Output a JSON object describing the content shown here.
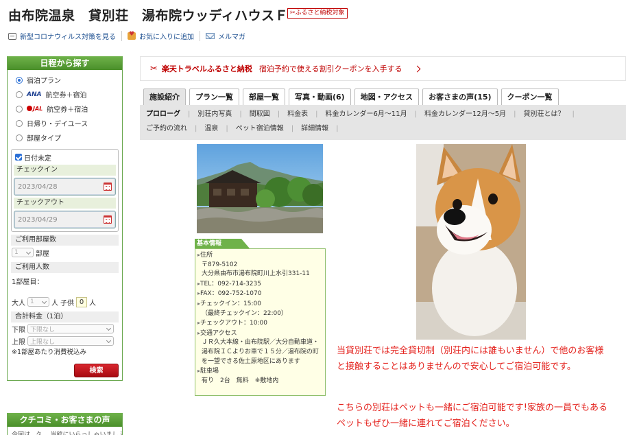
{
  "header": {
    "title": "由布院温泉　貸別荘　湯布院ウッディハウスＦ",
    "badge": "ふるさと納税対象"
  },
  "toplinks": [
    {
      "label": "新型コロナウィルス対策を見る",
      "icon": "info-box-icon"
    },
    {
      "label": "お気に入りに追加",
      "icon": "favorite-icon"
    },
    {
      "label": "メルマガ",
      "icon": "mail-icon"
    }
  ],
  "sidebar": {
    "heading": "日程から探す",
    "plan_types": [
      {
        "label": "宿泊プラン",
        "selected": true,
        "prefix": ""
      },
      {
        "label": "航空券＋宿泊",
        "selected": false,
        "prefix": "ANA"
      },
      {
        "label": "航空券＋宿泊",
        "selected": false,
        "prefix": "JAL"
      },
      {
        "label": "日帰り・デイユース",
        "selected": false,
        "prefix": ""
      },
      {
        "label": "部屋タイプ",
        "selected": false,
        "prefix": ""
      }
    ],
    "date_undecided": "日付未定",
    "checkin_label": "チェックイン",
    "checkin_value": "2023/04/28",
    "checkout_label": "チェックアウト",
    "checkout_value": "2023/04/29",
    "rooms_label": "ご利用部屋数",
    "rooms_value": "1",
    "rooms_unit": "部屋",
    "guests_label": "ご利用人数",
    "room1_label": "1部屋目：",
    "adult_label": "大人",
    "adult_value": "1",
    "adult_unit": "人",
    "child_label": "子供",
    "child_value": "0",
    "child_unit": "人",
    "total_label": "合計料金（1泊）",
    "min_label": "下限",
    "min_value": "下限なし",
    "max_label": "上限",
    "max_value": "上限なし",
    "tax_note": "※1部屋あたり消費税込み",
    "search_button": "検索",
    "review_heading": "クチコミ・お客さまの声",
    "review_snippet": "今回は、久... 当館にいらっしゃいまし 選"
  },
  "banner": {
    "brand": "楽天トラベルふるさと納税",
    "text": "宿泊予約で使える割引クーポンを入手する"
  },
  "tabs": [
    {
      "label": "施設紹介",
      "active": true
    },
    {
      "label": "プラン一覧",
      "active": false
    },
    {
      "label": "部屋一覧",
      "active": false
    },
    {
      "label": "写真・動画(6)",
      "active": false
    },
    {
      "label": "地図・アクセス",
      "active": false
    },
    {
      "label": "お客さまの声(15)",
      "active": false
    },
    {
      "label": "クーポン一覧",
      "active": false
    }
  ],
  "subnav": [
    {
      "label": "プロローグ",
      "bold": true
    },
    {
      "label": "別荘内写真",
      "bold": false
    },
    {
      "label": "間取図",
      "bold": false
    },
    {
      "label": "料金表",
      "bold": false
    },
    {
      "label": "料金カレンダー6月～11月",
      "bold": false
    },
    {
      "label": "料金カレンダー12月～5月",
      "bold": false
    },
    {
      "label": "貸別荘とは？",
      "bold": false
    },
    {
      "label": "ご予約の流れ",
      "bold": false
    },
    {
      "label": "温泉",
      "bold": false
    },
    {
      "label": "ペット宿泊情報",
      "bold": false
    },
    {
      "label": "詳細情報",
      "bold": false
    }
  ],
  "info": {
    "heading": "基本情報",
    "address_label": "住所",
    "postal": "〒879-5102",
    "address": "大分県由布市湯布院町川上水引331-11",
    "tel": "TEL：092-714-3235",
    "fax": "FAX：092-752-1070",
    "checkin": "チェックイン：15:00",
    "last_checkin": "（最終チェックイン：22:00）",
    "checkout": "チェックアウト：10:00",
    "access_label": "交通アクセス",
    "access_text": "ＪＲ久大本線・由布院駅／大分自動車道・湯布院ＩＣよりお車で１５分／湯布院の町を一望できる佐土原地区にあります",
    "parking_label": "駐車場",
    "parking_text": "有り　2台　無料　※敷地内"
  },
  "content": {
    "paragraph1": "当貸別荘では完全貸切制（別荘内には誰もいません）で他のお客様と接触することはありませんので安心してご宿泊可能です。",
    "paragraph2": "こちらの別荘はペットも一緒にご宿泊可能です!家族の一員でもあるペットもぜひ一緒に連れてご宿泊ください。"
  }
}
